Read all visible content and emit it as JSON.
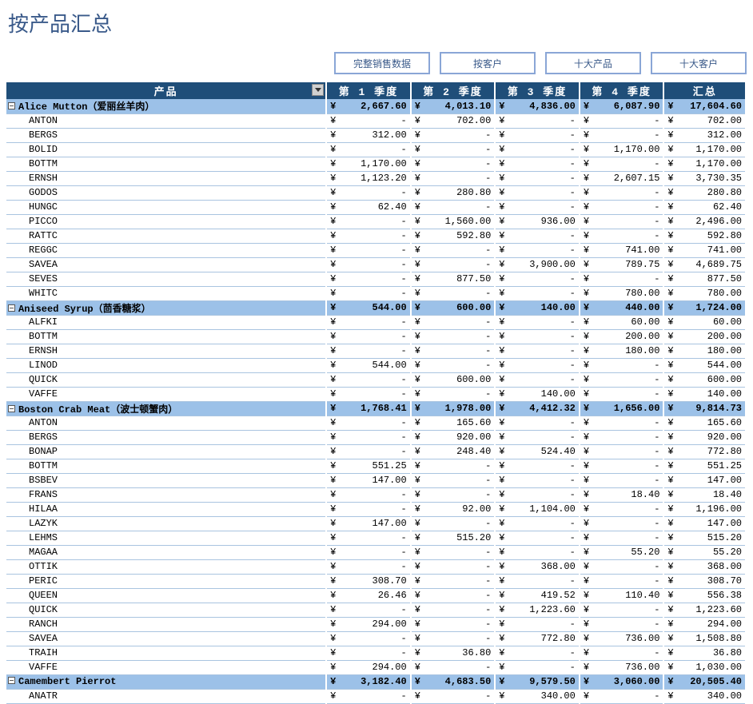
{
  "title": "按产品汇总",
  "nav": {
    "full_sales_data": "完整销售数据",
    "by_customer": "按客户",
    "top10_products": "十大产品",
    "top10_customers": "十大客户"
  },
  "columns": {
    "product": "产品",
    "q1": "第 1 季度",
    "q2": "第 2 季度",
    "q3": "第 3 季度",
    "q4": "第 4 季度",
    "total": "汇总"
  },
  "currency": "¥",
  "dash": "-",
  "rows": [
    {
      "type": "group",
      "label": "Alice Mutton（爱丽丝羊肉）",
      "q1": "2,667.60",
      "q2": "4,013.10",
      "q3": "4,836.00",
      "q4": "6,087.90",
      "total": "17,604.60"
    },
    {
      "type": "detail",
      "label": "ANTON",
      "q1": "-",
      "q2": "702.00",
      "q3": "-",
      "q4": "-",
      "total": "702.00"
    },
    {
      "type": "detail",
      "label": "BERGS",
      "q1": "312.00",
      "q2": "-",
      "q3": "-",
      "q4": "-",
      "total": "312.00"
    },
    {
      "type": "detail",
      "label": "BOLID",
      "q1": "-",
      "q2": "-",
      "q3": "-",
      "q4": "1,170.00",
      "total": "1,170.00"
    },
    {
      "type": "detail",
      "label": "BOTTM",
      "q1": "1,170.00",
      "q2": "-",
      "q3": "-",
      "q4": "-",
      "total": "1,170.00"
    },
    {
      "type": "detail",
      "label": "ERNSH",
      "q1": "1,123.20",
      "q2": "-",
      "q3": "-",
      "q4": "2,607.15",
      "total": "3,730.35"
    },
    {
      "type": "detail",
      "label": "GODOS",
      "q1": "-",
      "q2": "280.80",
      "q3": "-",
      "q4": "-",
      "total": "280.80"
    },
    {
      "type": "detail",
      "label": "HUNGC",
      "q1": "62.40",
      "q2": "-",
      "q3": "-",
      "q4": "-",
      "total": "62.40"
    },
    {
      "type": "detail",
      "label": "PICCO",
      "q1": "-",
      "q2": "1,560.00",
      "q3": "936.00",
      "q4": "-",
      "total": "2,496.00"
    },
    {
      "type": "detail",
      "label": "RATTC",
      "q1": "-",
      "q2": "592.80",
      "q3": "-",
      "q4": "-",
      "total": "592.80"
    },
    {
      "type": "detail",
      "label": "REGGC",
      "q1": "-",
      "q2": "-",
      "q3": "-",
      "q4": "741.00",
      "total": "741.00"
    },
    {
      "type": "detail",
      "label": "SAVEA",
      "q1": "-",
      "q2": "-",
      "q3": "3,900.00",
      "q4": "789.75",
      "total": "4,689.75"
    },
    {
      "type": "detail",
      "label": "SEVES",
      "q1": "-",
      "q2": "877.50",
      "q3": "-",
      "q4": "-",
      "total": "877.50"
    },
    {
      "type": "detail",
      "label": "WHITC",
      "q1": "-",
      "q2": "-",
      "q3": "-",
      "q4": "780.00",
      "total": "780.00"
    },
    {
      "type": "group",
      "label": "Aniseed Syrup（茴香糖浆）",
      "q1": "544.00",
      "q2": "600.00",
      "q3": "140.00",
      "q4": "440.00",
      "total": "1,724.00"
    },
    {
      "type": "detail",
      "label": "ALFKI",
      "q1": "-",
      "q2": "-",
      "q3": "-",
      "q4": "60.00",
      "total": "60.00"
    },
    {
      "type": "detail",
      "label": "BOTTM",
      "q1": "-",
      "q2": "-",
      "q3": "-",
      "q4": "200.00",
      "total": "200.00"
    },
    {
      "type": "detail",
      "label": "ERNSH",
      "q1": "-",
      "q2": "-",
      "q3": "-",
      "q4": "180.00",
      "total": "180.00"
    },
    {
      "type": "detail",
      "label": "LINOD",
      "q1": "544.00",
      "q2": "-",
      "q3": "-",
      "q4": "-",
      "total": "544.00"
    },
    {
      "type": "detail",
      "label": "QUICK",
      "q1": "-",
      "q2": "600.00",
      "q3": "-",
      "q4": "-",
      "total": "600.00"
    },
    {
      "type": "detail",
      "label": "VAFFE",
      "q1": "-",
      "q2": "-",
      "q3": "140.00",
      "q4": "-",
      "total": "140.00"
    },
    {
      "type": "group",
      "label": "Boston Crab Meat（波士顿蟹肉）",
      "q1": "1,768.41",
      "q2": "1,978.00",
      "q3": "4,412.32",
      "q4": "1,656.00",
      "total": "9,814.73"
    },
    {
      "type": "detail",
      "label": "ANTON",
      "q1": "-",
      "q2": "165.60",
      "q3": "-",
      "q4": "-",
      "total": "165.60"
    },
    {
      "type": "detail",
      "label": "BERGS",
      "q1": "-",
      "q2": "920.00",
      "q3": "-",
      "q4": "-",
      "total": "920.00"
    },
    {
      "type": "detail",
      "label": "BONAP",
      "q1": "-",
      "q2": "248.40",
      "q3": "524.40",
      "q4": "-",
      "total": "772.80"
    },
    {
      "type": "detail",
      "label": "BOTTM",
      "q1": "551.25",
      "q2": "-",
      "q3": "-",
      "q4": "-",
      "total": "551.25"
    },
    {
      "type": "detail",
      "label": "BSBEV",
      "q1": "147.00",
      "q2": "-",
      "q3": "-",
      "q4": "-",
      "total": "147.00"
    },
    {
      "type": "detail",
      "label": "FRANS",
      "q1": "-",
      "q2": "-",
      "q3": "-",
      "q4": "18.40",
      "total": "18.40"
    },
    {
      "type": "detail",
      "label": "HILAA",
      "q1": "-",
      "q2": "92.00",
      "q3": "1,104.00",
      "q4": "-",
      "total": "1,196.00"
    },
    {
      "type": "detail",
      "label": "LAZYK",
      "q1": "147.00",
      "q2": "-",
      "q3": "-",
      "q4": "-",
      "total": "147.00"
    },
    {
      "type": "detail",
      "label": "LEHMS",
      "q1": "-",
      "q2": "515.20",
      "q3": "-",
      "q4": "-",
      "total": "515.20"
    },
    {
      "type": "detail",
      "label": "MAGAA",
      "q1": "-",
      "q2": "-",
      "q3": "-",
      "q4": "55.20",
      "total": "55.20"
    },
    {
      "type": "detail",
      "label": "OTTIK",
      "q1": "-",
      "q2": "-",
      "q3": "368.00",
      "q4": "-",
      "total": "368.00"
    },
    {
      "type": "detail",
      "label": "PERIC",
      "q1": "308.70",
      "q2": "-",
      "q3": "-",
      "q4": "-",
      "total": "308.70"
    },
    {
      "type": "detail",
      "label": "QUEEN",
      "q1": "26.46",
      "q2": "-",
      "q3": "419.52",
      "q4": "110.40",
      "total": "556.38"
    },
    {
      "type": "detail",
      "label": "QUICK",
      "q1": "-",
      "q2": "-",
      "q3": "1,223.60",
      "q4": "-",
      "total": "1,223.60"
    },
    {
      "type": "detail",
      "label": "RANCH",
      "q1": "294.00",
      "q2": "-",
      "q3": "-",
      "q4": "-",
      "total": "294.00"
    },
    {
      "type": "detail",
      "label": "SAVEA",
      "q1": "-",
      "q2": "-",
      "q3": "772.80",
      "q4": "736.00",
      "total": "1,508.80"
    },
    {
      "type": "detail",
      "label": "TRAIH",
      "q1": "-",
      "q2": "36.80",
      "q3": "-",
      "q4": "-",
      "total": "36.80"
    },
    {
      "type": "detail",
      "label": "VAFFE",
      "q1": "294.00",
      "q2": "-",
      "q3": "-",
      "q4": "736.00",
      "total": "1,030.00"
    },
    {
      "type": "group",
      "label": "Camembert Pierrot",
      "q1": "3,182.40",
      "q2": "4,683.50",
      "q3": "9,579.50",
      "q4": "3,060.00",
      "total": "20,505.40"
    },
    {
      "type": "detail",
      "label": "ANATR",
      "q1": "-",
      "q2": "-",
      "q3": "340.00",
      "q4": "-",
      "total": "340.00"
    }
  ]
}
